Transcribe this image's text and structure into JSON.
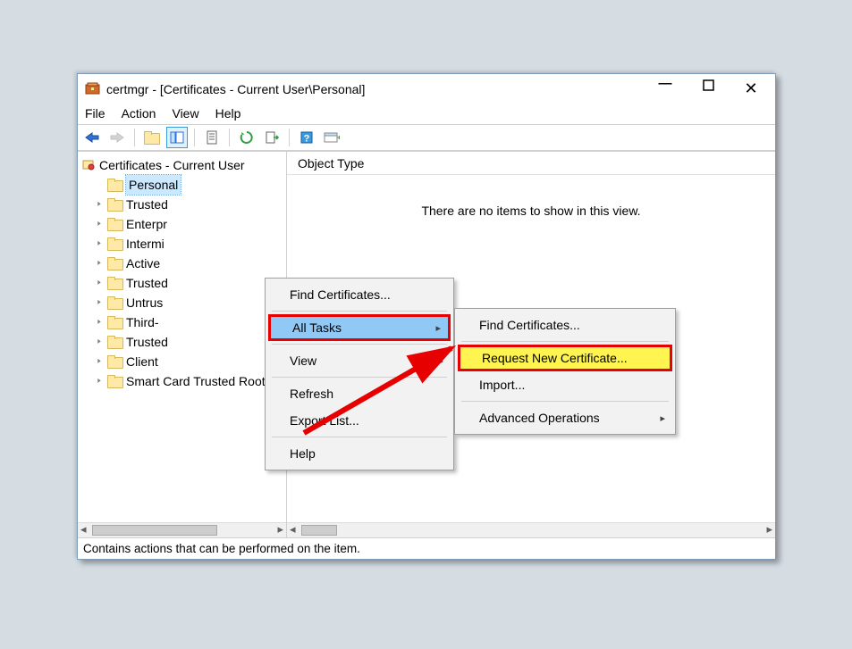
{
  "title": "certmgr - [Certificates - Current User\\Personal]",
  "menubar": {
    "file": "File",
    "action": "Action",
    "view": "View",
    "help": "Help"
  },
  "tree": {
    "root": "Certificates - Current User",
    "items": [
      "Personal",
      "Trusted",
      "Enterpr",
      "Intermi",
      "Active",
      "Trusted",
      "Untrus",
      "Third-",
      "Trusted",
      "Client",
      "Smart Card Trusted Roots"
    ],
    "selected_index": 0
  },
  "right": {
    "header": "Object Type",
    "empty": "There are no items to show in this view."
  },
  "statusbar": "Contains actions that can be performed on the item.",
  "context_menu_1": {
    "find": "Find Certificates...",
    "all_tasks": "All Tasks",
    "view": "View",
    "refresh": "Refresh",
    "export": "Export List...",
    "help": "Help"
  },
  "context_menu_2": {
    "find": "Find Certificates...",
    "request": "Request New Certificate...",
    "import": "Import...",
    "advanced": "Advanced Operations"
  },
  "toolbar_icons": [
    "nav-back",
    "nav-forward",
    "folder-up",
    "show-hide-tree",
    "properties",
    "refresh",
    "export",
    "help",
    "options"
  ]
}
